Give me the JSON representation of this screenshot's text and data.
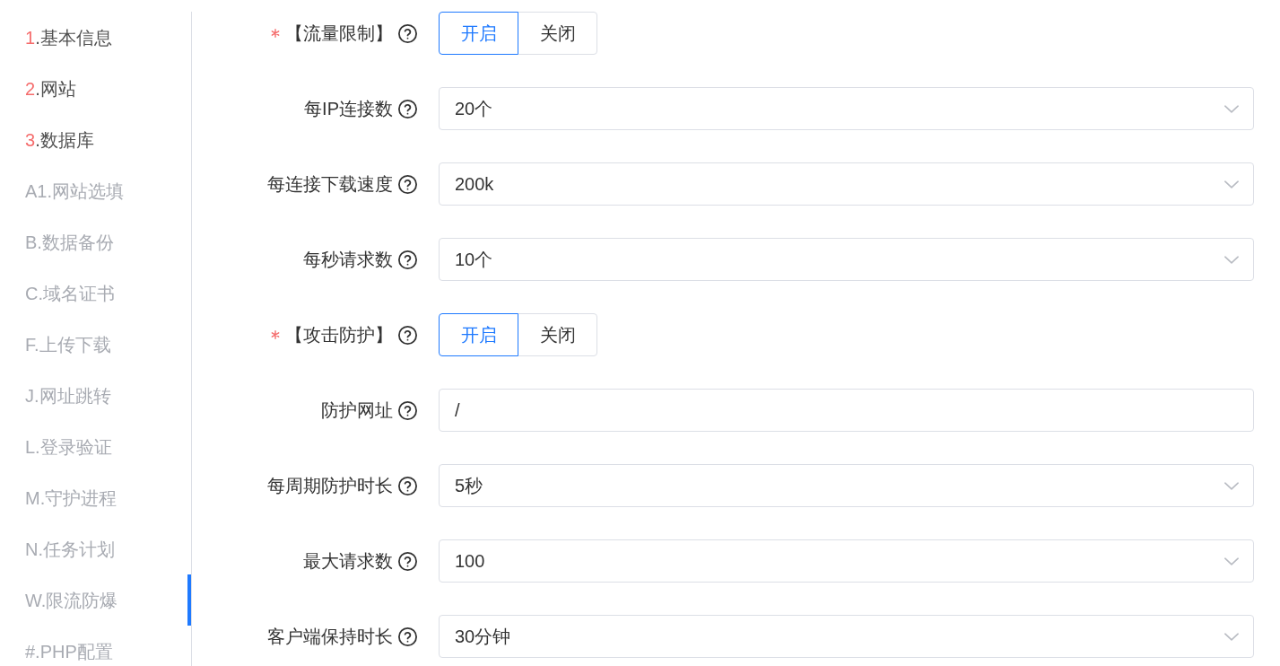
{
  "sidebar": {
    "items": [
      {
        "kind": "required",
        "prefix": "1",
        "label": ".基本信息",
        "selected": false
      },
      {
        "kind": "required",
        "prefix": "2",
        "label": ".网站",
        "selected": false
      },
      {
        "kind": "required",
        "prefix": "3",
        "label": ".数据库",
        "selected": false
      },
      {
        "kind": "optional",
        "label": "A1.网站选填",
        "selected": false
      },
      {
        "kind": "optional",
        "label": "B.数据备份",
        "selected": false
      },
      {
        "kind": "optional",
        "label": "C.域名证书",
        "selected": false
      },
      {
        "kind": "optional",
        "label": "F.上传下载",
        "selected": false
      },
      {
        "kind": "optional",
        "label": "J.网址跳转",
        "selected": false
      },
      {
        "kind": "optional",
        "label": "L.登录验证",
        "selected": false
      },
      {
        "kind": "optional",
        "label": "M.守护进程",
        "selected": false
      },
      {
        "kind": "optional",
        "label": "N.任务计划",
        "selected": false
      },
      {
        "kind": "optional",
        "label": "W.限流防爆",
        "selected": true
      },
      {
        "kind": "optional",
        "label": "#.PHP配置",
        "selected": false
      }
    ]
  },
  "form": {
    "fields": [
      {
        "kind": "toggle",
        "required": true,
        "label": "【流量限制】",
        "options": [
          {
            "label": "开启",
            "selected": true
          },
          {
            "label": "关闭",
            "selected": false
          }
        ]
      },
      {
        "kind": "select",
        "required": false,
        "label": "每IP连接数",
        "value": "20个"
      },
      {
        "kind": "select",
        "required": false,
        "label": "每连接下载速度",
        "value": "200k"
      },
      {
        "kind": "select",
        "required": false,
        "label": "每秒请求数",
        "value": "10个"
      },
      {
        "kind": "toggle",
        "required": true,
        "label": "【攻击防护】",
        "options": [
          {
            "label": "开启",
            "selected": true
          },
          {
            "label": "关闭",
            "selected": false
          }
        ]
      },
      {
        "kind": "input",
        "required": false,
        "label": "防护网址",
        "value": "/"
      },
      {
        "kind": "select",
        "required": false,
        "label": "每周期防护时长",
        "value": "5秒"
      },
      {
        "kind": "select",
        "required": false,
        "label": "最大请求数",
        "value": "100"
      },
      {
        "kind": "select",
        "required": false,
        "label": "客户端保持时长",
        "value": "30分钟"
      }
    ]
  }
}
